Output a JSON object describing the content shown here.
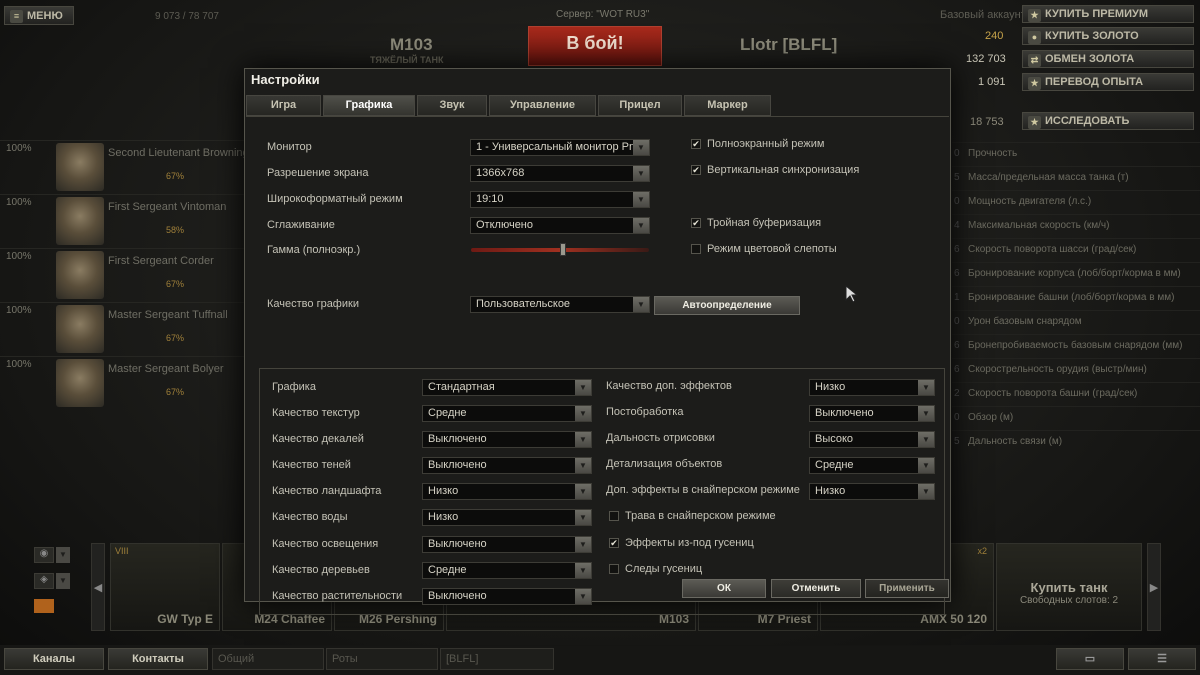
{
  "colors": {
    "accent": "#b8862a",
    "battle_button": "#8a1c14",
    "modal_bg": "#1c1c1a"
  },
  "top": {
    "menu": "МЕНЮ",
    "xp_counter": "9 073 / 78 707",
    "server": "Сервер: \"WOT RU3\"",
    "tank_name": "M103",
    "tank_class": "ТЯЖЁЛЫЙ ТАНК",
    "battle": "В бой!",
    "player": "Llotr [BLFL]",
    "account": "Базовый аккаунт",
    "buy_premium": "КУПИТЬ ПРЕМИУМ",
    "gold": "240",
    "buy_gold": "КУПИТЬ ЗОЛОТО",
    "credits": "132 703",
    "exchange_gold": "ОБМЕН ЗОЛОТА",
    "free_xp": "1 091",
    "convert_xp": "ПЕРЕВОД ОПЫТА",
    "research_xp": "18 753",
    "research": "ИССЛЕДОВАТЬ"
  },
  "crew": [
    {
      "pct": "100%",
      "name": "Second Lieutenant Browning",
      "skill": "67%"
    },
    {
      "pct": "100%",
      "name": "First Sergeant Vintoman",
      "skill": "58%"
    },
    {
      "pct": "100%",
      "name": "First Sergeant Corder",
      "skill": "67%"
    },
    {
      "pct": "100%",
      "name": "Master Sergeant Tuffnall",
      "skill": "67%"
    },
    {
      "pct": "100%",
      "name": "Master Sergeant Bolyer",
      "skill": "67%"
    }
  ],
  "stats": [
    "Прочность",
    "Масса/предельная масса танка (т)",
    "Мощность двигателя (л.с.)",
    "Максимальная скорость (км/ч)",
    "Скорость поворота шасси (град/сек)",
    "Бронирование корпуса (лоб/борт/корма в мм)",
    "Бронирование башни (лоб/борт/корма в мм)",
    "Урон базовым снарядом",
    "Бронепробиваемость базовым снарядом (мм)",
    "Скорострельность орудия (выстр/мин)",
    "Скорость поворота башни (град/сек)",
    "Обзор (м)",
    "Дальность связи (м)"
  ],
  "carousel": {
    "tier": "VIII",
    "tanks": [
      "GW Typ E",
      "M24 Chaffee",
      "M26 Pershing",
      "M103",
      "M7 Priest",
      "AMX 50 120"
    ],
    "x2": "x2",
    "buy_tank": "Купить танк",
    "free_slots": "Свободных слотов: 2"
  },
  "bottom": {
    "channels": "Каналы",
    "contacts": "Контакты",
    "common": "Общий",
    "companies": "Роты",
    "clan": "[BLFL]"
  },
  "dialog": {
    "title": "Настройки",
    "tabs": [
      "Игра",
      "Графика",
      "Звук",
      "Управление",
      "Прицел",
      "Маркер"
    ],
    "monitor_label": "Монитор",
    "monitor_value": "1 - Универсальный монитор PnP",
    "resolution_label": "Разрешение экрана",
    "resolution_value": "1366x768",
    "widescreen_label": "Широкоформатный режим",
    "widescreen_value": "19:10",
    "aa_label": "Сглаживание",
    "aa_value": "Отключено",
    "gamma_label": "Гамма (полноэкр.)",
    "gamma_level": 0.52,
    "fullscreen": "Полноэкранный режим",
    "vsync": "Вертикальная синхронизация",
    "triple_buffer": "Тройная буферизация",
    "colorblind": "Режим цветовой слепоты",
    "quality_label": "Качество графики",
    "quality_value": "Пользовательское",
    "auto_detect": "Автоопределение",
    "left_settings": [
      {
        "label": "Графика",
        "value": "Стандартная"
      },
      {
        "label": "Качество текстур",
        "value": "Средне"
      },
      {
        "label": "Качество декалей",
        "value": "Выключено"
      },
      {
        "label": "Качество теней",
        "value": "Выключено"
      },
      {
        "label": "Качество ландшафта",
        "value": "Низко"
      },
      {
        "label": "Качество воды",
        "value": "Низко"
      },
      {
        "label": "Качество освещения",
        "value": "Выключено"
      },
      {
        "label": "Качество деревьев",
        "value": "Средне"
      },
      {
        "label": "Качество растительности",
        "value": "Выключено"
      }
    ],
    "right_settings": [
      {
        "label": "Качество доп. эффектов",
        "value": "Низко"
      },
      {
        "label": "Постобработка",
        "value": "Выключено"
      },
      {
        "label": "Дальность отрисовки",
        "value": "Высоко"
      },
      {
        "label": "Детализация объектов",
        "value": "Средне"
      },
      {
        "label": "Доп. эффекты в снайперском режиме",
        "value": "Низко"
      }
    ],
    "grass_sniper": "Трава в снайперском режиме",
    "track_effects": "Эффекты из-под гусениц",
    "track_marks": "Следы гусениц",
    "ok": "ОК",
    "cancel": "Отменить",
    "apply": "Применить"
  }
}
